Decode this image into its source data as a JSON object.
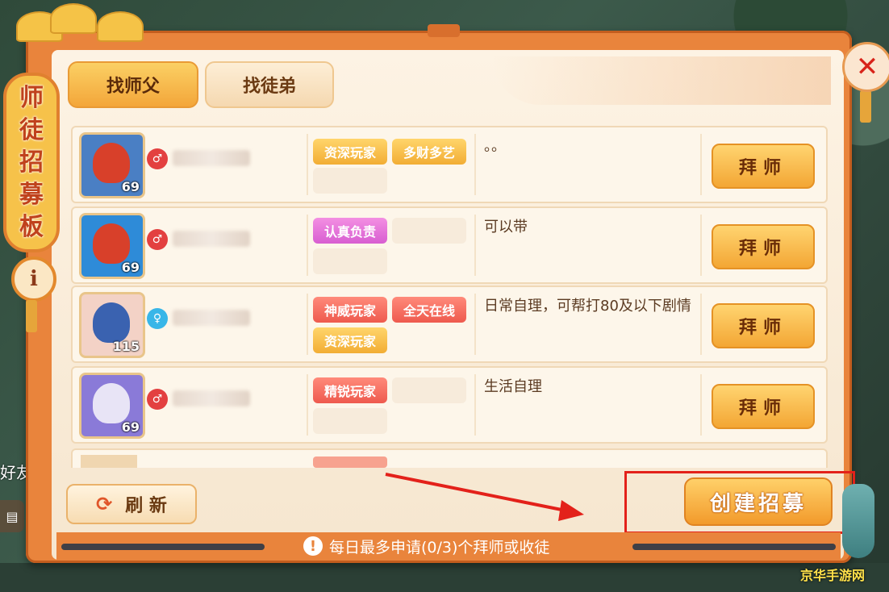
{
  "board_title": [
    "师",
    "徒",
    "招",
    "募",
    "板"
  ],
  "info_icon": "i",
  "close_icon": "✕",
  "tabs": [
    {
      "label": "找师父",
      "active": true
    },
    {
      "label": "找徒弟",
      "active": false
    }
  ],
  "rows": [
    {
      "level": "69",
      "gender_icon": "male-icon",
      "tags": [
        "资深玩家",
        "多财多艺"
      ],
      "tag_colors": [
        "gold",
        "gold"
      ],
      "note": "。。",
      "button": "拜师"
    },
    {
      "level": "69",
      "gender_icon": "male-icon",
      "tags": [
        "认真负责"
      ],
      "tag_colors": [
        "pink"
      ],
      "note": "可以带",
      "button": "拜师"
    },
    {
      "level": "115",
      "gender_icon": "female-icon",
      "tags": [
        "神威玩家",
        "全天在线",
        "资深玩家"
      ],
      "tag_colors": [
        "red",
        "red",
        "gold"
      ],
      "note": "日常自理，可帮打80及以下剧情",
      "button": "拜师"
    },
    {
      "level": "69",
      "gender_icon": "male-icon",
      "tags": [
        "精锐玩家"
      ],
      "tag_colors": [
        "red"
      ],
      "note": "生活自理",
      "button": "拜师"
    }
  ],
  "refresh_label": "刷 新",
  "create_label": "创建招募",
  "footer_note": "每日最多申请(0/3)个拜师或收徒",
  "side_labels": {
    "friend": "好友"
  },
  "watermark": "京华手游网",
  "colors": {
    "accent_orange": "#e9843c",
    "button_gold": "#f3a634",
    "highlight_red": "#e3211a"
  }
}
